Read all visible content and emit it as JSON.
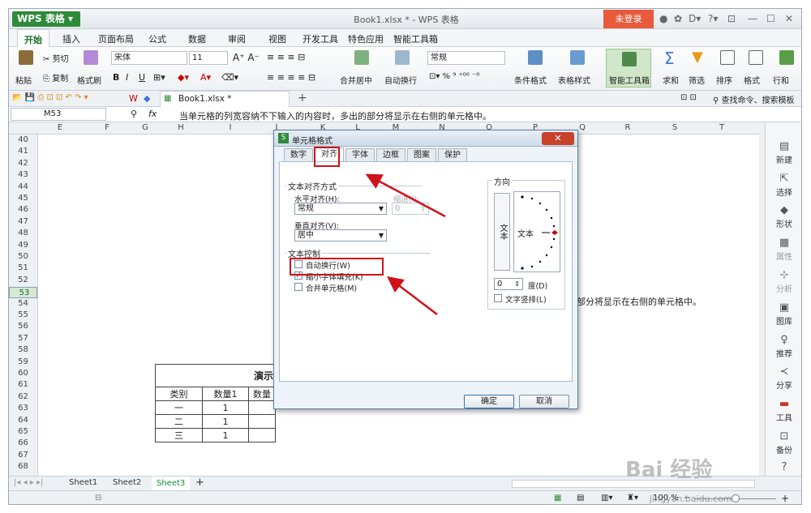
{
  "app": {
    "brand": "WPS 表格",
    "title": "Book1.xlsx * - WPS 表格",
    "login": "未登录"
  },
  "tabs": [
    "开始",
    "插入",
    "页面布局",
    "公式",
    "数据",
    "审阅",
    "视图",
    "开发工具",
    "特色应用",
    "智能工具箱"
  ],
  "ribbon": {
    "paste": "粘贴",
    "cut": "剪切",
    "copy": "复制",
    "format_painter": "格式刷",
    "font_name": "宋体",
    "font_size": "11",
    "merge": "合并居中",
    "wrap": "自动换行",
    "number_format": "常规",
    "cond_format": "条件格式",
    "table_style": "表格样式",
    "smart_toolbox": "智能工具箱",
    "sum": "求和",
    "filter": "筛选",
    "sort": "排序",
    "format": "格式",
    "rowcol": "行和"
  },
  "qat": {
    "file_tab": "Book1.xlsx *",
    "search": "查找命令、搜索模板"
  },
  "formula": {
    "cell": "M53",
    "fx": "fx",
    "content": "当单元格的列宽容纳不下输入的内容时，多出的部分将显示在右侧的单元格中。"
  },
  "columns": [
    "E",
    "F",
    "G",
    "H",
    "I",
    "J",
    "K",
    "L",
    "M",
    "N",
    "O",
    "P",
    "Q",
    "R",
    "S",
    "T"
  ],
  "rows": [
    "40",
    "41",
    "42",
    "43",
    "44",
    "45",
    "46",
    "47",
    "48",
    "49",
    "50",
    "51",
    "52",
    "53",
    "54",
    "55",
    "56",
    "57",
    "58",
    "59",
    "60",
    "61",
    "62",
    "63",
    "64",
    "65",
    "66",
    "67",
    "68"
  ],
  "sheet_table": {
    "title": "演示",
    "headers": [
      "类别",
      "数量1",
      "数量"
    ],
    "rows": [
      [
        "一",
        "1",
        ""
      ],
      [
        "二",
        "1",
        ""
      ],
      [
        "三",
        "1",
        ""
      ]
    ]
  },
  "overflow_text": "部分将显示在右侧的单元格中。",
  "side_panel": [
    "新建",
    "选择",
    "形状",
    "属性",
    "分析",
    "图库",
    "推荐",
    "分享",
    "工具",
    "备份",
    "帮助"
  ],
  "sheets": [
    "Sheet1",
    "Sheet2",
    "Sheet3"
  ],
  "status": {
    "zoom": "100 %"
  },
  "dialog": {
    "title": "单元格格式",
    "tabs": [
      "数字",
      "对齐",
      "字体",
      "边框",
      "图案",
      "保护"
    ],
    "text_align_group": "文本对齐方式",
    "h_align_label": "水平对齐(H):",
    "h_align_value": "常规",
    "indent_label": "缩进(I):",
    "indent_value": "0",
    "v_align_label": "垂直对齐(V):",
    "v_align_value": "居中",
    "text_control_group": "文本控制",
    "wrap_label": "自动换行(W)",
    "shrink_label": "缩小字体填充(K)",
    "shrink_checked": true,
    "merge_label": "合并单元格(M)",
    "orientation_group": "方向",
    "vertical_text": "文本",
    "orient_text": "文本",
    "degree_value": "0",
    "degree_label": "度(D)",
    "vertical_stack_label": "文字竖排(L)",
    "ok": "确定",
    "cancel": "取消"
  },
  "watermark": {
    "main": "Bai 经验",
    "sub": "jingyan.baidu.com"
  }
}
